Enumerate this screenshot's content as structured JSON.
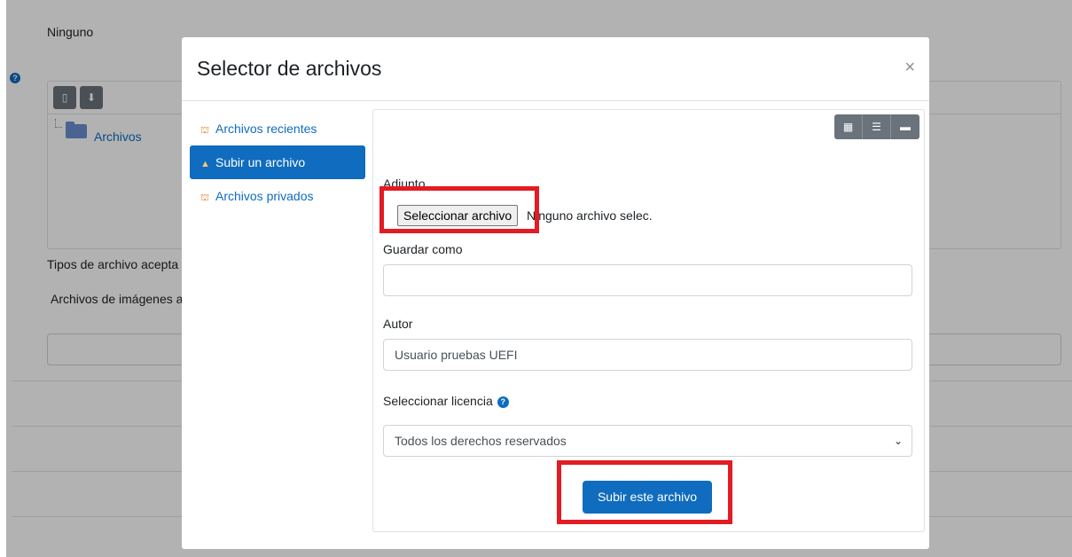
{
  "background": {
    "selected_value": "Ninguno",
    "file_manager_folder": "Archivos",
    "accepted_types_label": "Tipos de archivo acepta",
    "images_label": "Archivos de imágenes a"
  },
  "modal": {
    "title": "Selector de archivos",
    "close_glyph": "×",
    "nav": {
      "items": [
        {
          "label": "Archivos recientes",
          "icon": "repository-icon"
        },
        {
          "label": "Subir un archivo",
          "icon": "upload-icon"
        },
        {
          "label": "Archivos privados",
          "icon": "repository-icon"
        }
      ],
      "active_index": 1
    },
    "view_toggle": {
      "icons": [
        "grid-view-icon",
        "list-view-icon",
        "folder-view-icon"
      ]
    },
    "form": {
      "attachment_label": "Adjunto",
      "file_button_label": "Seleccionar archivo",
      "file_status": "Ninguno archivo selec.",
      "save_as_label": "Guardar como",
      "save_as_value": "",
      "author_label": "Autor",
      "author_value": "Usuario pruebas UEFI",
      "license_label": "Seleccionar licencia",
      "license_value": "Todos los derechos reservados",
      "submit_label": "Subir este archivo"
    }
  },
  "colors": {
    "primary": "#0f6cbf",
    "highlight": "#e31b23",
    "overlay": "rgba(0,0,0,0.3)"
  }
}
